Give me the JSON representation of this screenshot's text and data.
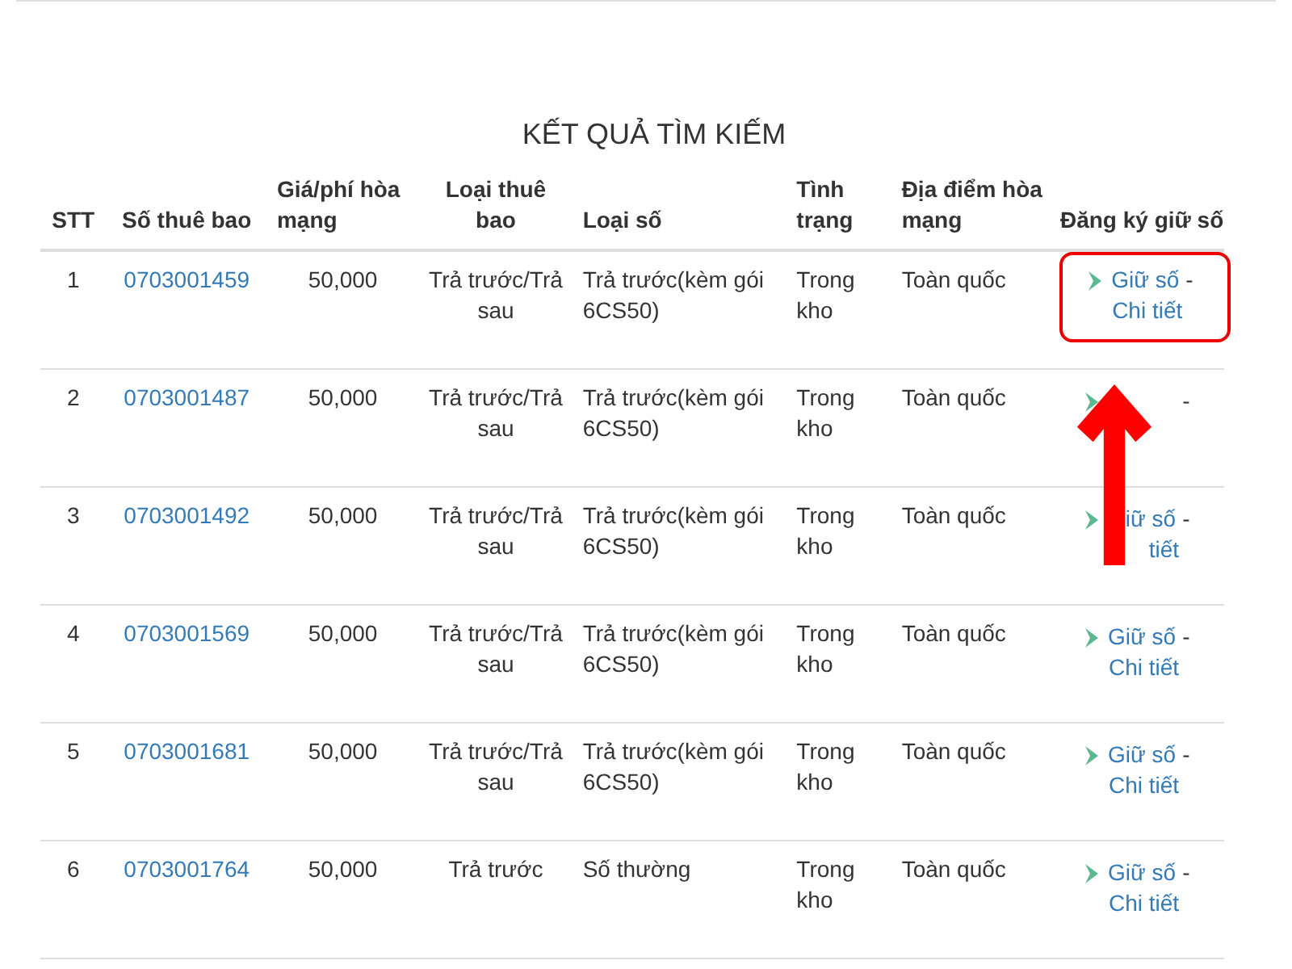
{
  "title": "KẾT QUẢ TÌM KIẾM",
  "columns": [
    "STT",
    "Số thuê bao",
    "Giá/phí hòa mạng",
    "Loại thuê bao",
    "Loại số",
    "Tình trạng",
    "Địa điểm hòa mạng",
    "Đăng ký giữ số"
  ],
  "rows": [
    {
      "stt": "1",
      "number": "0703001459",
      "fee": "50,000",
      "subscriber_type": "Trả trước/Trả sau",
      "number_type": "Trả trước(kèm gói 6CS50)",
      "status": "Trong kho",
      "location": "Toàn quốc",
      "hold_link": "Giữ số",
      "separator": "-",
      "detail_link": "Chi tiết",
      "highlighted": true
    },
    {
      "stt": "2",
      "number": "0703001487",
      "fee": "50,000",
      "subscriber_type": "Trả trước/Trả sau",
      "number_type": "Trả trước(kèm gói 6CS50)",
      "status": "Trong kho",
      "location": "Toàn quốc",
      "separator": "-",
      "highlighted": false
    },
    {
      "stt": "3",
      "number": "0703001492",
      "fee": "50,000",
      "subscriber_type": "Trả trước/Trả sau",
      "number_type": "Trả trước(kèm gói 6CS50)",
      "status": "Trong kho",
      "location": "Toàn quốc",
      "hold_link": "iữ số",
      "separator": "-",
      "detail_link": "tiết",
      "highlighted": false
    },
    {
      "stt": "4",
      "number": "0703001569",
      "fee": "50,000",
      "subscriber_type": "Trả trước/Trả sau",
      "number_type": "Trả trước(kèm gói 6CS50)",
      "status": "Trong kho",
      "location": "Toàn quốc",
      "hold_link": "Giữ số",
      "separator": "-",
      "detail_link": "Chi tiết",
      "highlighted": false
    },
    {
      "stt": "5",
      "number": "0703001681",
      "fee": "50,000",
      "subscriber_type": "Trả trước/Trả sau",
      "number_type": "Trả trước(kèm gói 6CS50)",
      "status": "Trong kho",
      "location": "Toàn quốc",
      "hold_link": "Giữ số",
      "separator": "-",
      "detail_link": "Chi tiết",
      "highlighted": false
    },
    {
      "stt": "6",
      "number": "0703001764",
      "fee": "50,000",
      "subscriber_type": "Trả trước",
      "number_type": "Số thường",
      "status": "Trong kho",
      "location": "Toàn quốc",
      "hold_link": "Giữ số",
      "separator": "-",
      "detail_link": "Chi tiết",
      "highlighted": false
    }
  ]
}
